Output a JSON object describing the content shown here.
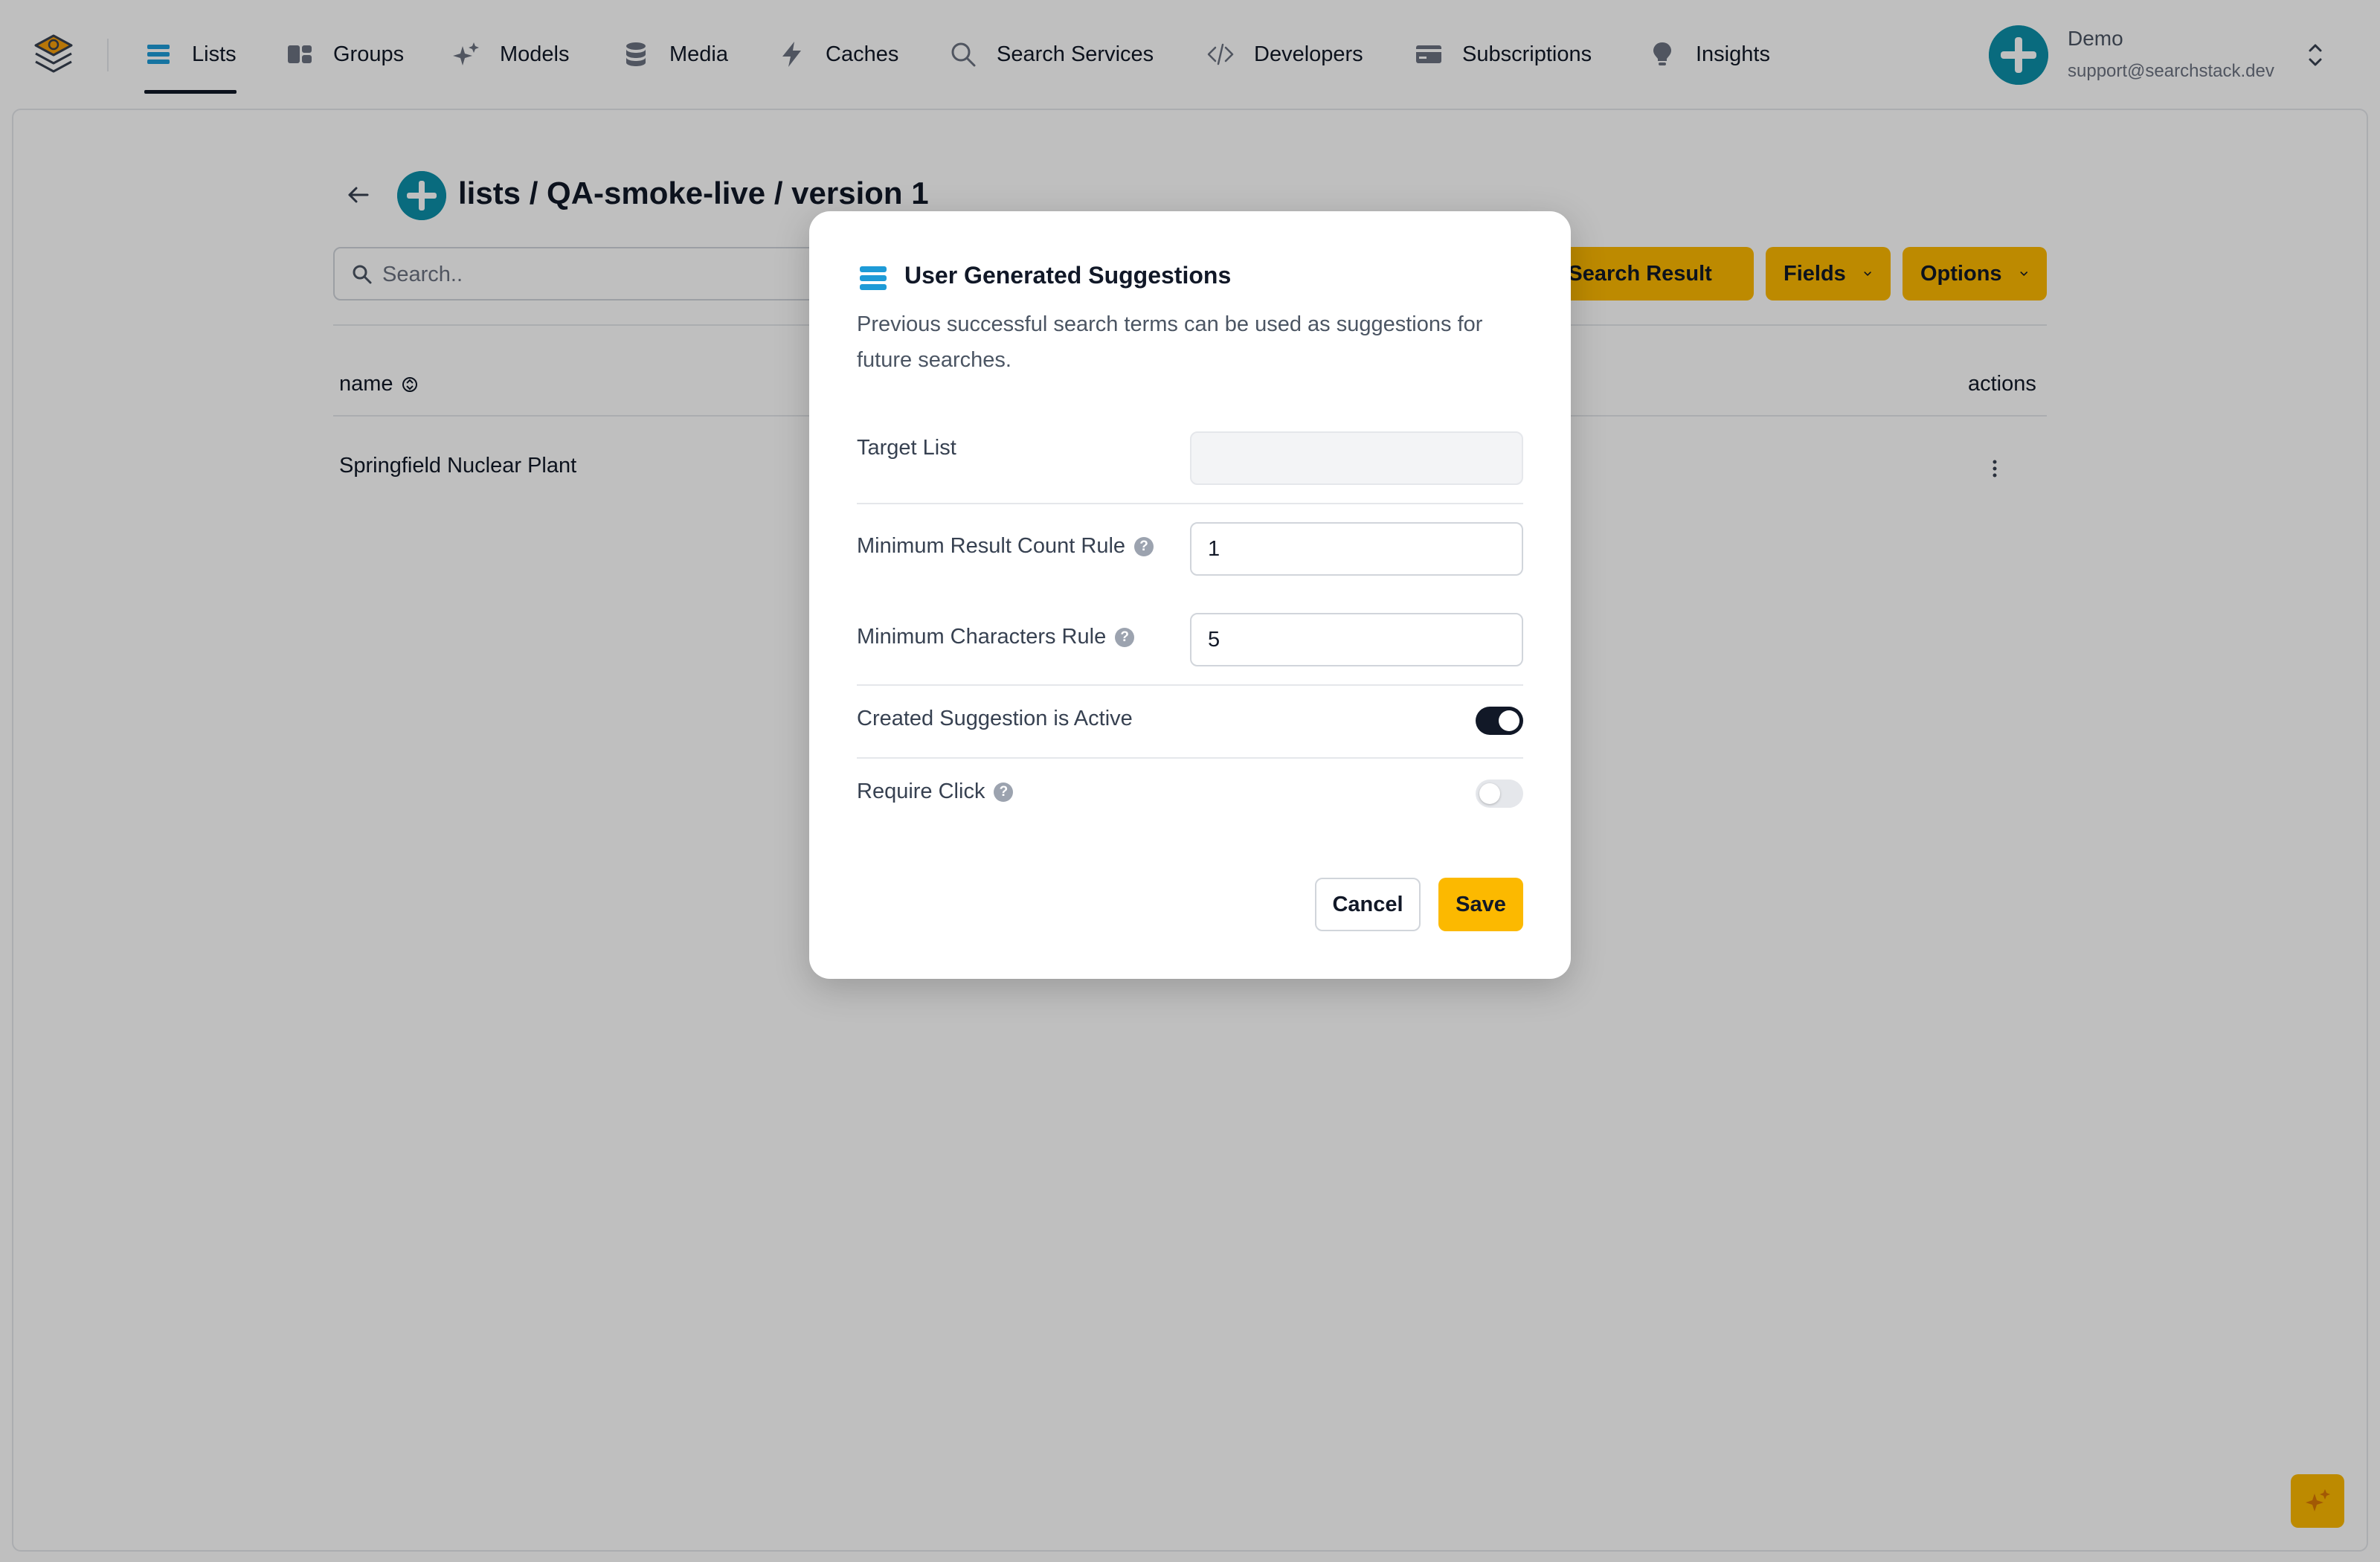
{
  "nav": {
    "items": [
      {
        "label": "Lists",
        "icon": "list-icon"
      },
      {
        "label": "Groups",
        "icon": "groups-icon"
      },
      {
        "label": "Models",
        "icon": "sparkles-icon"
      },
      {
        "label": "Media",
        "icon": "database-icon"
      },
      {
        "label": "Caches",
        "icon": "bolt-icon"
      },
      {
        "label": "Search Services",
        "icon": "search-icon"
      },
      {
        "label": "Developers",
        "icon": "code-icon"
      },
      {
        "label": "Subscriptions",
        "icon": "credit-card-icon"
      },
      {
        "label": "Insights",
        "icon": "lightbulb-icon"
      }
    ],
    "active": "Lists"
  },
  "profile": {
    "name": "Demo",
    "email": "support@searchstack.dev"
  },
  "page": {
    "title": "lists / QA-smoke-live / version 1",
    "search_placeholder": "Search..",
    "add_search_result_label": "Add Search Result",
    "fields_label": "Fields",
    "options_label": "Options"
  },
  "table": {
    "columns": {
      "name": "name",
      "actions": "actions"
    },
    "rows": [
      {
        "name": "Springfield Nuclear Plant"
      }
    ]
  },
  "modal": {
    "title": "User Generated Suggestions",
    "description": "Previous successful search terms can be used as suggestions for future searches.",
    "target_list_label": "Target List",
    "target_list_value": "",
    "min_result_count_label": "Minimum Result Count Rule",
    "min_result_count_value": "1",
    "min_chars_label": "Minimum Characters Rule",
    "min_chars_value": "5",
    "created_active_label": "Created Suggestion is Active",
    "created_active": true,
    "require_click_label": "Require Click",
    "require_click": false,
    "help_glyph": "?",
    "cancel_label": "Cancel",
    "save_label": "Save"
  },
  "colors": {
    "accent": "#fcb900",
    "brand_teal": "#0c8fa8",
    "icon_blue": "#1e9bd7",
    "overlay": "rgba(0,0,0,0.25)"
  }
}
